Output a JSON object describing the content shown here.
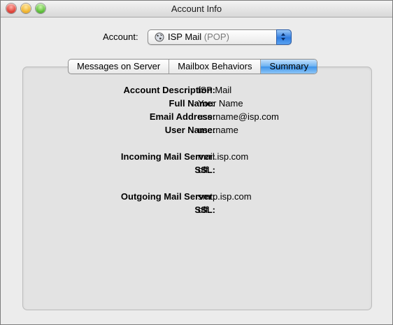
{
  "window": {
    "title": "Account Info"
  },
  "account": {
    "label": "Account:",
    "selected_name": "ISP Mail",
    "selected_type": "(POP)"
  },
  "tabs": [
    {
      "label": "Messages on Server",
      "active": false
    },
    {
      "label": "Mailbox Behaviors",
      "active": false
    },
    {
      "label": "Summary",
      "active": true
    }
  ],
  "summary": {
    "account_description": {
      "label": "Account Description:",
      "value": "ISP Mail"
    },
    "full_name": {
      "label": "Full Name:",
      "value": "Your Name"
    },
    "email_address": {
      "label": "Email Address:",
      "value": "username@isp.com"
    },
    "user_name": {
      "label": "User Name:",
      "value": "username"
    },
    "incoming_server": {
      "label": "Incoming Mail Server:",
      "value": "mail.isp.com"
    },
    "incoming_ssl": {
      "label": "SSL:",
      "value": "off"
    },
    "outgoing_server": {
      "label": "Outgoing Mail Server:",
      "value": "smtp.isp.com"
    },
    "outgoing_ssl": {
      "label": "SSL:",
      "value": "off"
    }
  },
  "colors": {
    "accent": "#3d93ea",
    "window_bg": "#ececec",
    "panel_bg": "#e3e3e3"
  },
  "icons": [
    "close-button",
    "minimize-button",
    "zoom-button",
    "globe-icon",
    "popup-arrows-icon"
  ]
}
